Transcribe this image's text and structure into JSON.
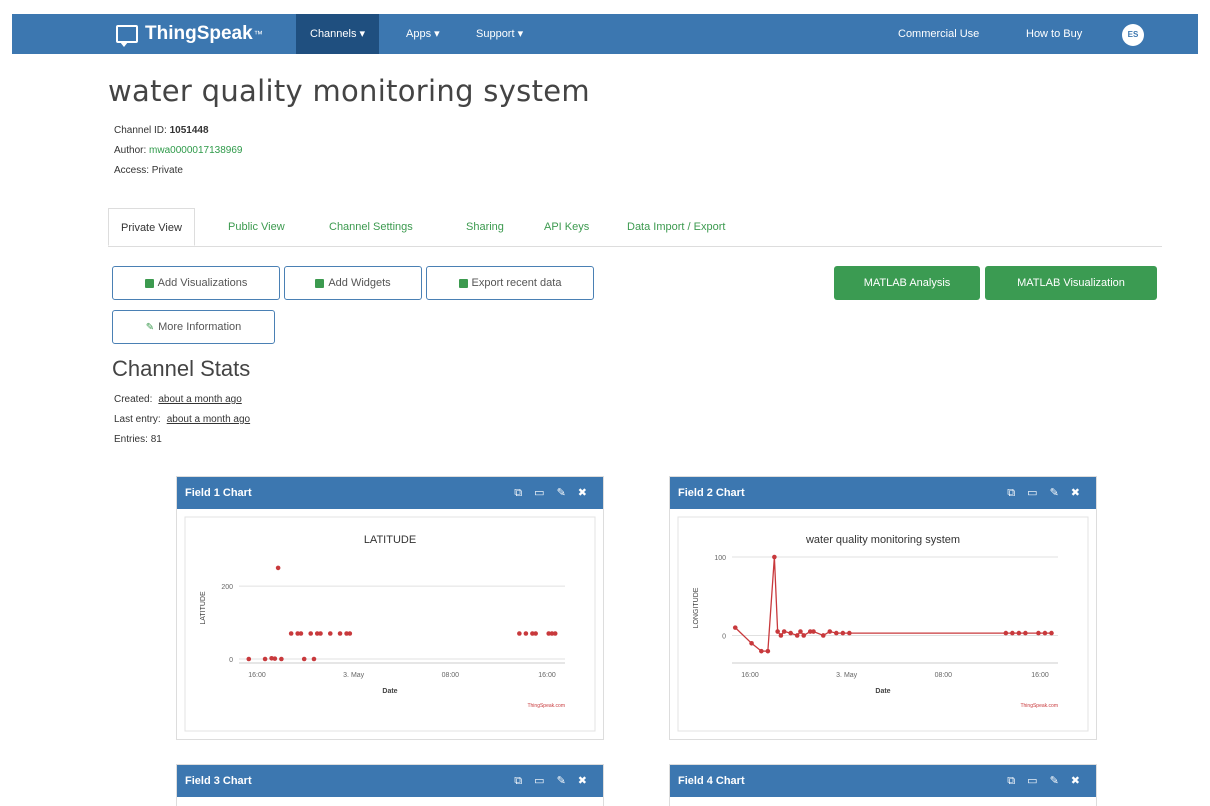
{
  "nav": {
    "brand": "ThingSpeak",
    "brand_tm": "™",
    "items": [
      "Channels ▾",
      "Apps ▾",
      "Support ▾"
    ],
    "right": [
      "Commercial Use",
      "How to Buy"
    ],
    "avatar": "ES"
  },
  "channel": {
    "title": "water quality monitoring system",
    "id_label": "Channel ID:",
    "id": "1051448",
    "author_label": "Author:",
    "author": "mwa0000017138969",
    "access_label": "Access:",
    "access": "Private"
  },
  "tabs": [
    "Private View",
    "Public View",
    "Channel Settings",
    "Sharing",
    "API Keys",
    "Data Import / Export"
  ],
  "buttons": {
    "add_visualizations": "Add Visualizations",
    "add_widgets": "Add Widgets",
    "export_recent": "Export recent data",
    "more_information": "More Information",
    "matlab_analysis": "MATLAB Analysis",
    "matlab_visualization": "MATLAB Visualization"
  },
  "stats": {
    "title": "Channel Stats",
    "created_label": "Created:",
    "created": "about a month ago",
    "last_entry_label": "Last entry:",
    "last_entry": "about a month ago",
    "entries_label": "Entries:",
    "entries": "81"
  },
  "colors": {
    "nav_bg": "#3c77b0",
    "nav_active": "#1f4f7f",
    "green": "#3b9b52",
    "series": "#c8393c"
  },
  "chart_data": [
    {
      "panel_title": "Field 1 Chart",
      "type": "scatter",
      "title": "LATITUDE",
      "xlabel": "Date",
      "ylabel": "LATITUDE",
      "x_ticks": [
        "16:00",
        "3. May",
        "08:00",
        "16:00"
      ],
      "y_ticks": [
        0,
        200
      ],
      "ylim": [
        0,
        280
      ],
      "credit": "ThingSpeak.com",
      "x_range": [
        0,
        100
      ],
      "x": [
        3,
        8,
        10,
        11,
        12,
        13,
        16,
        18,
        19,
        20,
        22,
        23,
        24,
        25,
        28,
        31,
        33,
        34,
        86,
        88,
        90,
        91,
        95,
        96,
        97
      ],
      "y": [
        0,
        0,
        0,
        0,
        0,
        0,
        0,
        0,
        0,
        0,
        0,
        0,
        0,
        0,
        0,
        0,
        0,
        0,
        0,
        0,
        0,
        0,
        0,
        0,
        0
      ],
      "y_values": [
        0,
        0,
        2,
        1,
        250,
        0,
        70,
        70,
        70,
        0,
        70,
        0,
        70,
        70,
        70,
        70,
        70,
        70,
        70,
        70,
        70,
        70,
        70,
        70,
        70
      ]
    },
    {
      "panel_title": "Field 2 Chart",
      "type": "line",
      "title": "water quality monitoring system",
      "xlabel": "Date",
      "ylabel": "LONGITUDE",
      "x_ticks": [
        "16:00",
        "3. May",
        "08:00",
        "16:00"
      ],
      "y_ticks": [
        0,
        100
      ],
      "ylim": [
        -30,
        100
      ],
      "credit": "ThingSpeak.com",
      "x_range": [
        0,
        100
      ],
      "x": [
        1,
        6,
        9,
        11,
        13,
        14,
        15,
        16,
        18,
        20,
        21,
        22,
        24,
        25,
        28,
        30,
        32,
        34,
        36,
        84,
        86,
        88,
        90,
        94,
        96,
        98
      ],
      "y": [
        10,
        -10,
        -20,
        -20,
        100,
        5,
        0,
        5,
        3,
        0,
        5,
        0,
        5,
        5,
        0,
        5,
        3,
        3,
        3,
        3,
        3,
        3,
        3,
        3,
        3,
        3
      ]
    },
    {
      "panel_title": "Field 3 Chart"
    },
    {
      "panel_title": "Field 4 Chart"
    }
  ]
}
